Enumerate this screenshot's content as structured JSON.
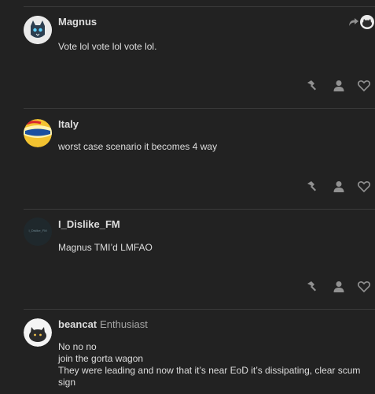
{
  "posts": [
    {
      "username": "Magnus",
      "title": "",
      "body": "Vote lol vote lol vote lol."
    },
    {
      "username": "Italy",
      "title": "",
      "body": "worst case scenario it becomes 4 way"
    },
    {
      "username": "I_Dislike_FM",
      "title": "",
      "body": "Magnus TMI’d LMFAO",
      "avatar_text": "I_Dislike_FM"
    },
    {
      "username": "beancat",
      "title": "Enthusiast",
      "body": "No no no\njoin the gorta wagon\nThey were leading and now that it’s near EoD it’s dissipating, clear scum sign"
    }
  ],
  "icons": {
    "bookmark": "hammer-icon",
    "user": "user-icon",
    "like": "heart-icon",
    "reply_to": "reply-arrow-icon"
  },
  "colors": {
    "background": "#222222",
    "divider": "#3a3a3a",
    "text": "#dddddd",
    "muted": "#919191"
  }
}
